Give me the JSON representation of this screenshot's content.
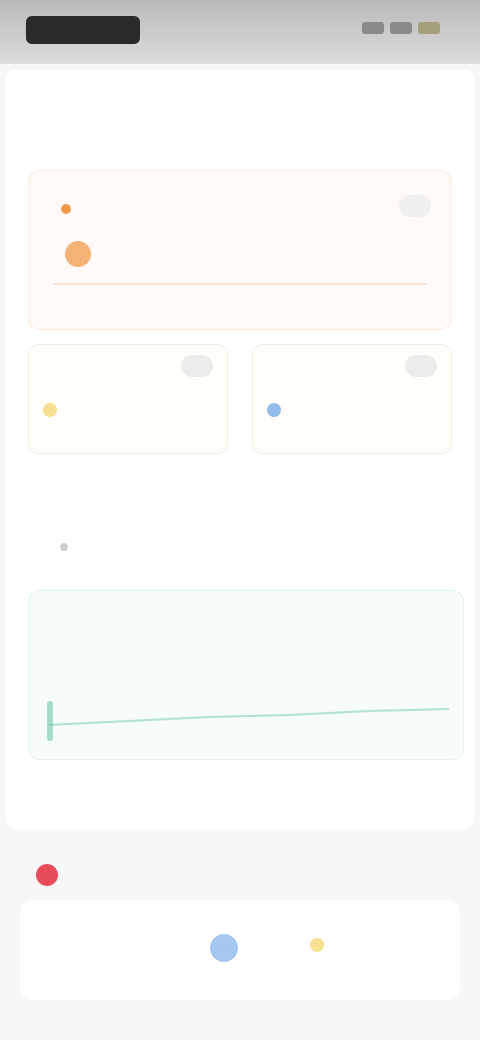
{
  "topbar": {
    "icons": [
      "logo-icon",
      "status-icon-1",
      "status-icon-2",
      "status-icon-3"
    ]
  },
  "sections": {
    "overview_title": "",
    "secondary_title": ""
  },
  "main_card": {
    "badge_label": "",
    "action_label": "",
    "highlight_value": ""
  },
  "small_cards": [
    {
      "label": "",
      "value": "",
      "accent": "#f2c94c"
    },
    {
      "label": "",
      "value": "",
      "accent": "#4a90e2"
    }
  ],
  "mid_block": {
    "small_label": "",
    "value": ""
  },
  "trend_card": {
    "title": "",
    "value": "",
    "footnote": "",
    "accent": "#6cc7a6"
  },
  "bottom_card": {
    "col1": "",
    "col2": "",
    "col3": ""
  },
  "colors": {
    "primary_text": "#4a5a78",
    "warning": "#f2994a",
    "danger": "#e74c5a"
  }
}
